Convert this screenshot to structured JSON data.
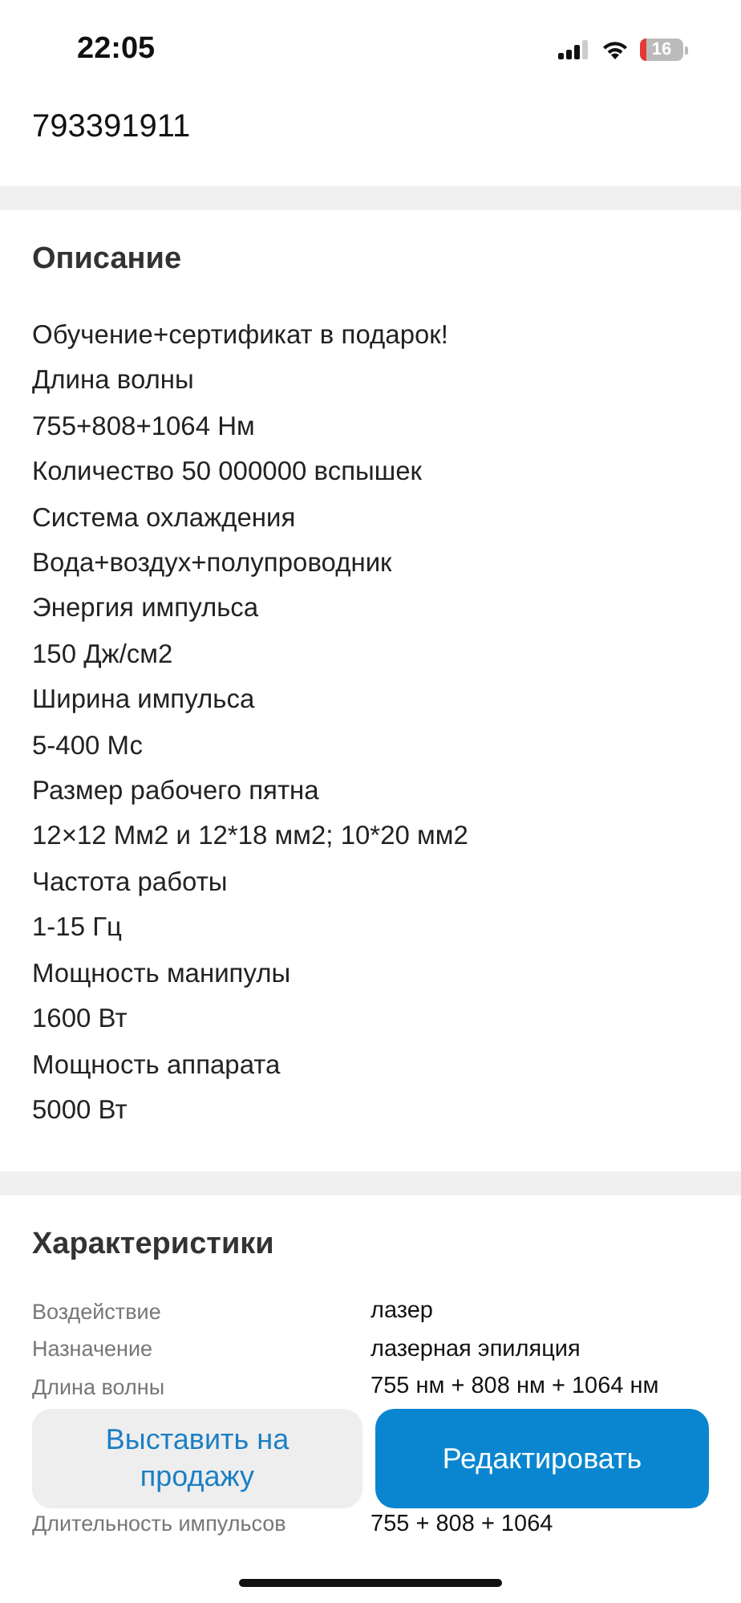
{
  "status_bar": {
    "time": "22:05",
    "battery": {
      "text": "16",
      "level": 0.16
    }
  },
  "listing_number": "793391911",
  "description": {
    "title": "Описание",
    "lines": [
      "Обучение+сертификат в подарок!",
      "Длина волны",
      "755+808+1064 Нм",
      "Количество 50 000000 вспышек",
      "Система охлаждения",
      "Вода+воздух+полупроводник",
      "Энергия импульса",
      "150 Дж/см2",
      "Ширина импульса",
      "5-400 Мс",
      "Размер рабочего пятна",
      "12×12 Мм2 и 12*18 мм2; 10*20 мм2",
      "Частота работы",
      "1-15 Гц",
      "Мощность манипулы",
      "1600 Вт",
      "Мощность аппарата",
      "5000 Вт"
    ]
  },
  "characteristics": {
    "title": "Характеристики",
    "rows": [
      {
        "label": "Воздействие",
        "value": "лазер"
      },
      {
        "label": "Назначение",
        "value": "лазерная эпиляция"
      },
      {
        "label": "Длина волны",
        "value": "755 нм + 808 нм + 1064 нм"
      },
      {
        "label": "Длительность импульсов",
        "value": "755 + 808 + 1064"
      }
    ]
  },
  "buttons": [
    {
      "label": "Выставить на продажу",
      "kind": "secondary"
    },
    {
      "label": "Редактировать",
      "kind": "primary"
    }
  ]
}
